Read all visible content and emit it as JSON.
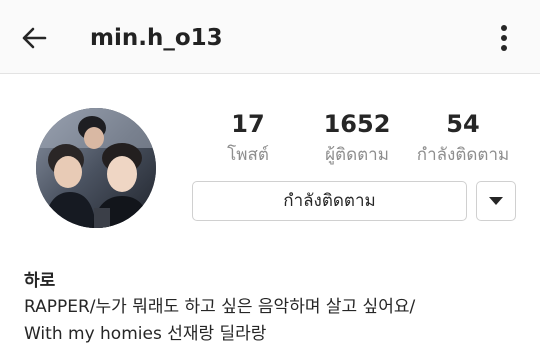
{
  "header": {
    "username": "min.h_o13",
    "back_icon": "arrow-left-icon",
    "more_icon": "more-vertical-icon"
  },
  "profile": {
    "avatar_icon": "profile-photo"
  },
  "stats": {
    "posts": {
      "count": "17",
      "label": "โพสต์"
    },
    "followers": {
      "count": "1652",
      "label": "ผู้ติดตาม"
    },
    "following": {
      "count": "54",
      "label": "กำลังติดตาม"
    }
  },
  "actions": {
    "follow_label": "กำลังติดตาม",
    "dropdown_icon": "caret-down-icon"
  },
  "bio": {
    "name": "하로",
    "lines": [
      "RAPPER/누가 뭐래도 하고 싶은 음악하며 살고 싶어요/",
      "With my homies 선재랑 딜라랑"
    ]
  }
}
